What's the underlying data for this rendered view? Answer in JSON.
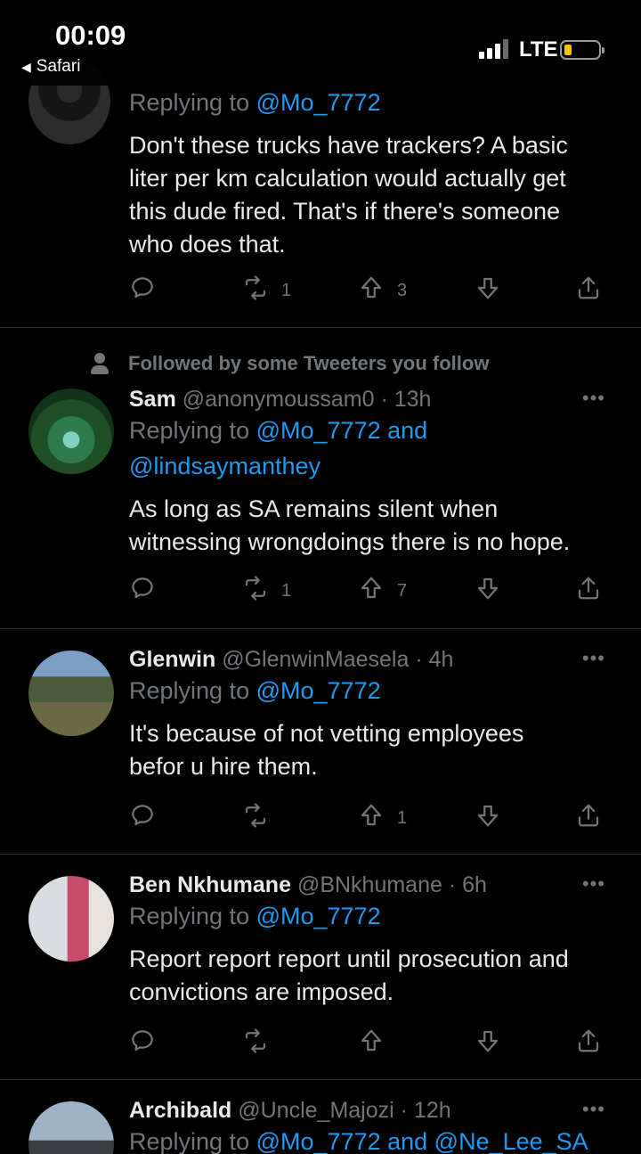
{
  "status_bar": {
    "time": "00:09",
    "back_label": "Safari",
    "network": "LTE",
    "battery_level": 0.18,
    "battery_color": "#f6c700"
  },
  "colors": {
    "link": "#1d9bf0",
    "muted": "#71767b",
    "text": "#e7e9ea",
    "background": "#000000"
  },
  "tweets": [
    {
      "reply_prefix": "Replying to",
      "mentions": "@Mo_7772",
      "text_lines": [
        "Don't these trucks have trackers? A basic",
        "liter per km calculation would actually get",
        "this dude fired. That's if there's someone",
        "who does that."
      ],
      "replies": "",
      "retweets": "1",
      "likes": "3"
    },
    {
      "social_context": "Followed by some Tweeters you follow",
      "name": "Sam",
      "handle": "@anonymoussam0",
      "time": "13h",
      "reply_prefix": "Replying to",
      "mentions_line1": "@Mo_7772 and",
      "mentions_line2": "@lindsaymanthey",
      "text_lines": [
        "As long as SA remains silent when",
        "witnessing wrongdoings there is no hope."
      ],
      "replies": "",
      "retweets": "1",
      "likes": "7"
    },
    {
      "name": "Glenwin",
      "handle": "@GlenwinMaesela",
      "time": "4h",
      "reply_prefix": "Replying to",
      "mentions": "@Mo_7772",
      "text_lines": [
        "It's because of not vetting employees",
        "befor u hire them."
      ],
      "replies": "",
      "retweets": "",
      "likes": "1"
    },
    {
      "name": "Ben Nkhumane",
      "handle": "@BNkhumane",
      "time": "6h",
      "reply_prefix": "Replying to",
      "mentions": "@Mo_7772",
      "text_lines": [
        "Report report report until prosecution and",
        "convictions are imposed."
      ],
      "replies": "",
      "retweets": "",
      "likes": ""
    },
    {
      "name": "Archibald",
      "handle": "@Uncle_Majozi",
      "time": "12h",
      "reply_prefix": "Replying to",
      "mentions": "@Mo_7772 and @Ne_Lee_SA"
    }
  ],
  "icons": [
    "reply-icon",
    "retweet-icon",
    "like-icon",
    "downvote-icon",
    "share-icon",
    "more-icon",
    "person-icon"
  ]
}
